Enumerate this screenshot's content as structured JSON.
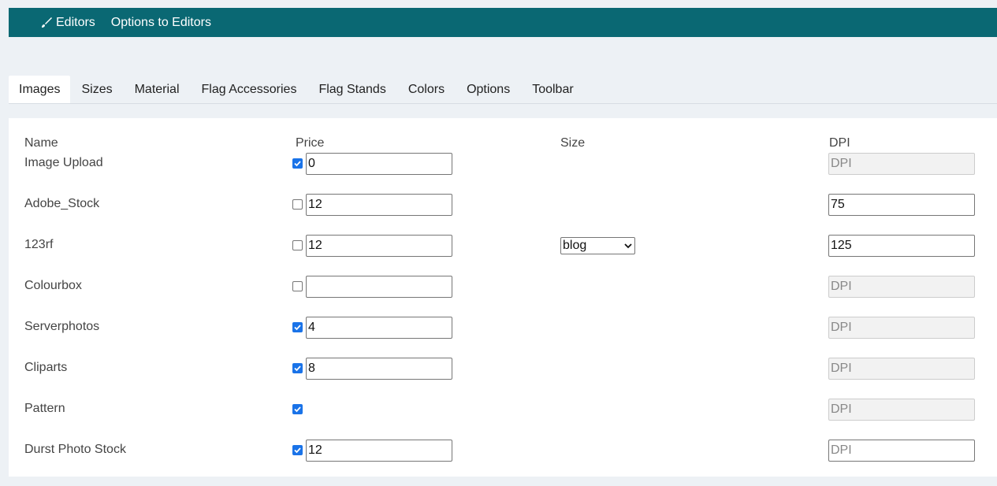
{
  "topbar": {
    "editors_label": "Editors",
    "options_label": "Options to Editors",
    "bg_color": "#0a6873"
  },
  "tabs": [
    {
      "label": "Images",
      "active": true
    },
    {
      "label": "Sizes"
    },
    {
      "label": "Material"
    },
    {
      "label": "Flag Accessories"
    },
    {
      "label": "Flag Stands"
    },
    {
      "label": "Colors"
    },
    {
      "label": "Options"
    },
    {
      "label": "Toolbar"
    }
  ],
  "table": {
    "headers": {
      "name": "Name",
      "price": "Price",
      "size": "Size",
      "dpi": "DPI"
    },
    "rows": [
      {
        "name": "Image Upload",
        "checked": true,
        "price": "0",
        "dpi": "",
        "dpi_placeholder": "DPI",
        "dpi_disabled": true
      },
      {
        "name": "Adobe_Stock",
        "checked": false,
        "price": "12",
        "dpi": "75",
        "dpi_disabled": false
      },
      {
        "name": "123rf",
        "checked": false,
        "price": "12",
        "size": "blog",
        "dpi": "125",
        "dpi_disabled": false
      },
      {
        "name": "Colourbox",
        "checked": false,
        "price": "",
        "dpi": "",
        "dpi_placeholder": "DPI",
        "dpi_disabled": true
      },
      {
        "name": "Serverphotos",
        "checked": true,
        "price": "4",
        "dpi": "",
        "dpi_placeholder": "DPI",
        "dpi_disabled": true
      },
      {
        "name": "Cliparts",
        "checked": true,
        "price": "8",
        "dpi": "",
        "dpi_placeholder": "DPI",
        "dpi_disabled": true
      },
      {
        "name": "Pattern",
        "checked": true,
        "no_price_field": true,
        "dpi": "",
        "dpi_placeholder": "DPI",
        "dpi_disabled": true
      },
      {
        "name": "Durst Photo Stock",
        "checked": true,
        "price": "12",
        "dpi": "",
        "dpi_placeholder": "DPI",
        "dpi_disabled": false
      }
    ]
  },
  "colors": {
    "accent": "#1a73e8"
  }
}
